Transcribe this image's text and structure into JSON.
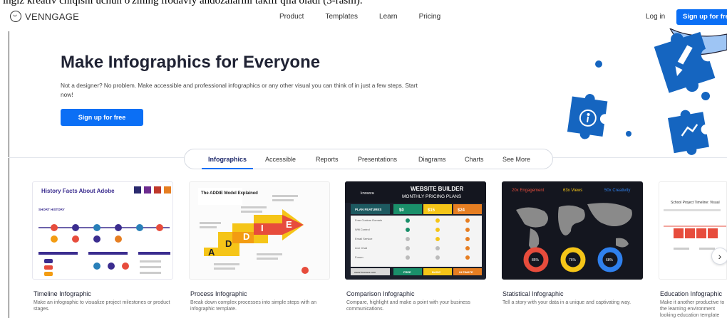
{
  "caption": "ingiz kreativ chiqishi uchun o'zining ifodaviy andozalarini taklif qila oladi (3-rasm).",
  "brand": {
    "name": "VENNGAGE"
  },
  "nav": {
    "links": [
      "Product",
      "Templates",
      "Learn",
      "Pricing"
    ],
    "login": "Log in",
    "signup": "Sign up for free"
  },
  "hero": {
    "title": "Make Infographics for Everyone",
    "description": "Not a designer? No problem. Make accessible and professional infographics or any other visual you can think of in just a few steps. Start now!",
    "cta": "Sign up for free"
  },
  "tabs": [
    "Infographics",
    "Accessible",
    "Reports",
    "Presentations",
    "Diagrams",
    "Charts",
    "See More"
  ],
  "active_tab": "Infographics",
  "colors": {
    "accent": "#0b6ff5",
    "puzzle": "#1565c0",
    "dark_card": "#14161f"
  },
  "cards": [
    {
      "title": "Timeline Infographic",
      "description": "Make an infographic to visualize project milestones or product stages.",
      "thumb_title": "History Facts About Adobe",
      "thumb_sub": "SHORT HISTORY"
    },
    {
      "title": "Process Infographic",
      "description": "Break down complex processes into simple steps with an infographic template.",
      "thumb_title": "The ADDIE Model Explained",
      "letters": [
        "A",
        "D",
        "D",
        "I",
        "E"
      ]
    },
    {
      "title": "Comparison Infographic",
      "description": "Compare, highlight and make a point with your business communications.",
      "thumb_title": "WEBSITE BUILDER",
      "thumb_sub": "MONTHLY PRICING PLANS",
      "thumb_brand": "knowza",
      "prices": [
        "$0",
        "$15",
        "$24"
      ],
      "features_header": "PLAN FEATURES",
      "features": [
        "Free Custom Domain",
        "Wifi Control",
        "Email Service",
        "Live Chat",
        "Forum"
      ],
      "plans": [
        "FREE",
        "BASIC",
        "ULTIMATE"
      ],
      "footer": "www.knowza.com"
    },
    {
      "title": "Statistical Infographic",
      "description": "Tell a story with your data in a unique and captivating way.",
      "stats": [
        "20x Engagement",
        "63x Views",
        "50x Creativity"
      ],
      "donuts": [
        "85%",
        "76%",
        "68%"
      ]
    },
    {
      "title": "Education Infographic",
      "description": "Make it another productive to the learning environment looking education template",
      "thumb_title": "School Project Timeline: Visual"
    }
  ]
}
